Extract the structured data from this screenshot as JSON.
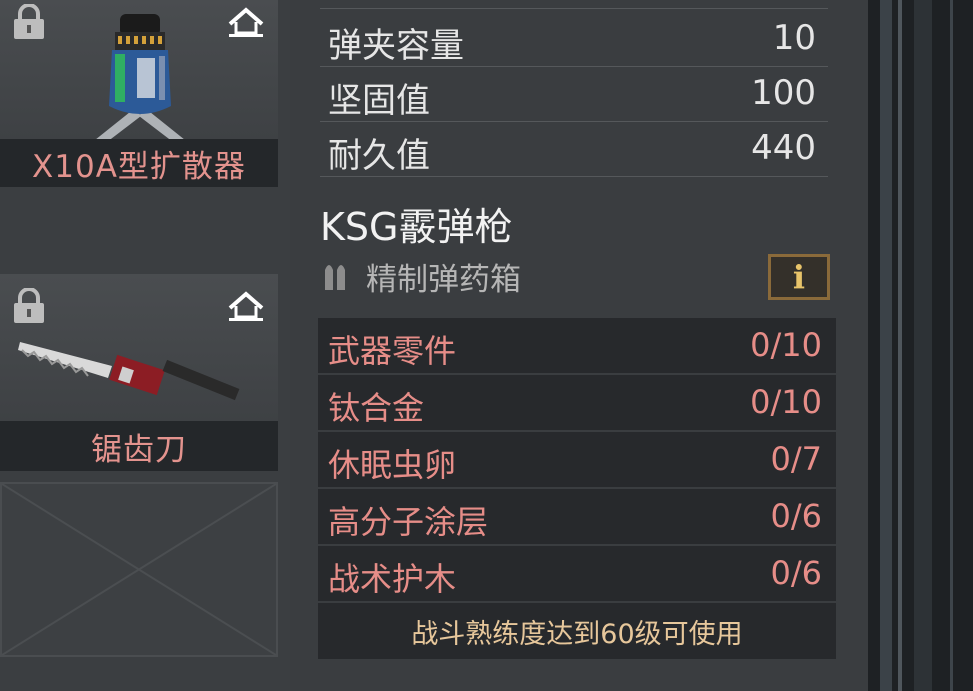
{
  "items": [
    {
      "name": "X10A型扩散器",
      "icon": "diffuser-device-icon",
      "locked": true
    },
    {
      "name": "锯齿刀",
      "icon": "saw-blade-weapon-icon",
      "locked": true
    },
    {
      "name": "",
      "icon": "empty-slot",
      "locked": false
    }
  ],
  "stats": [
    {
      "label": "弹夹容量",
      "value": "10"
    },
    {
      "label": "坚固值",
      "value": "100"
    },
    {
      "label": "耐久值",
      "value": "440"
    }
  ],
  "weapon": {
    "name": "KSG霰弹枪",
    "ammo_type": "精制弹药箱",
    "info_label": "i"
  },
  "materials": [
    {
      "label": "武器零件",
      "value": "0/10"
    },
    {
      "label": "钛合金",
      "value": "0/10"
    },
    {
      "label": "休眠虫卵",
      "value": "0/7"
    },
    {
      "label": "高分子涂层",
      "value": "0/6"
    },
    {
      "label": "战术护木",
      "value": "0/6"
    }
  ],
  "unlock_requirement": "战斗熟练度达到60级可使用",
  "colors": {
    "panel_bg": "#3a3d40",
    "material_text": "#e68d88",
    "item_name_text": "#e3938e",
    "requirement_text": "#e7c79b",
    "info_border": "#8a6a3a"
  }
}
